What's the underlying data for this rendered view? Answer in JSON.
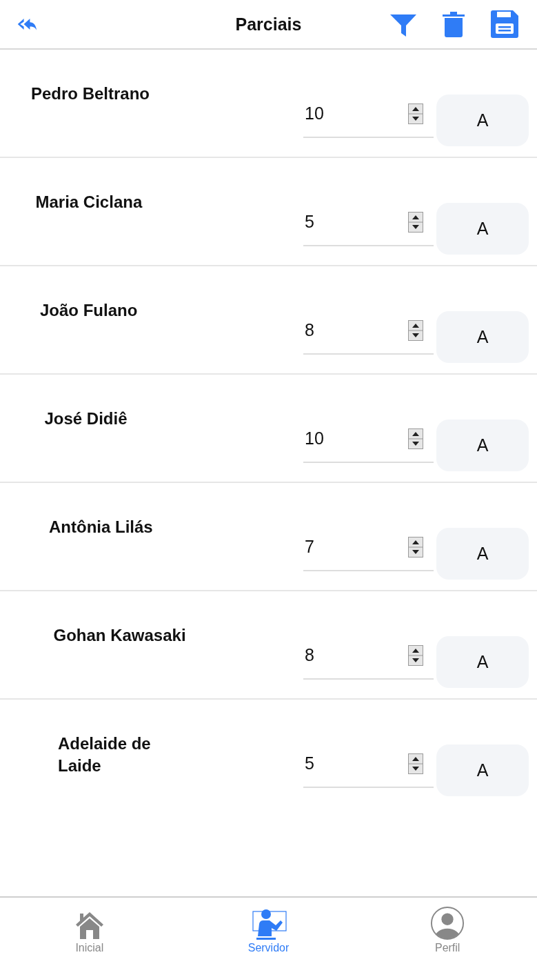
{
  "header": {
    "title": "Parciais"
  },
  "students": [
    {
      "name": "Pedro Beltrano",
      "grade": "10",
      "concept": "A"
    },
    {
      "name": "Maria Ciclana",
      "grade": "5",
      "concept": "A"
    },
    {
      "name": "João Fulano",
      "grade": "8",
      "concept": "A"
    },
    {
      "name": "José Didiê",
      "grade": "10",
      "concept": "A"
    },
    {
      "name": "Antônia Lilás",
      "grade": "7",
      "concept": "A"
    },
    {
      "name": "Gohan Kawasaki",
      "grade": "8",
      "concept": "A"
    },
    {
      "name": "Adelaide de Laide",
      "grade": "5",
      "concept": "A"
    }
  ],
  "nav": [
    {
      "label": "Inicial",
      "kind": "home",
      "selected": false
    },
    {
      "label": "Servidor",
      "kind": "teacher",
      "selected": true
    },
    {
      "label": "Perfil",
      "kind": "profile",
      "selected": false
    }
  ]
}
